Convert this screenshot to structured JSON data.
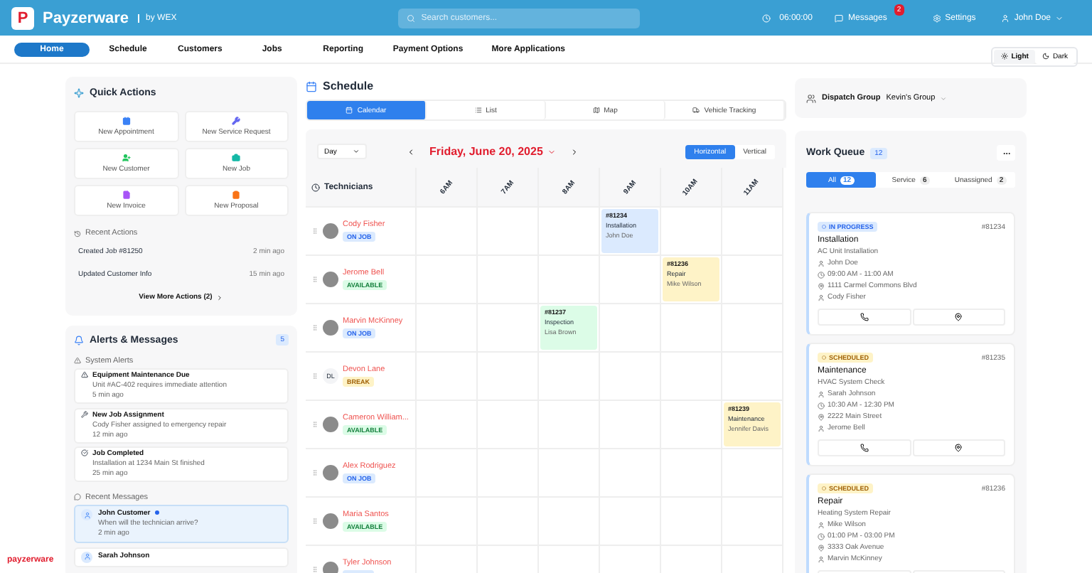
{
  "header": {
    "logo_letter": "P",
    "brand": "Payzerware",
    "by": "by WEX",
    "search_placeholder": "Search customers...",
    "time": "06:00:00",
    "messages": {
      "label": "Messages",
      "badge": "2"
    },
    "settings": "Settings",
    "user": "John Doe",
    "theme": [
      {
        "label": "Light",
        "kind": "sun",
        "selected": true
      },
      {
        "label": "Dark",
        "kind": "moon",
        "selected": false
      }
    ]
  },
  "nav": {
    "items": [
      {
        "label": "Home",
        "selected": true
      },
      {
        "label": "Schedule",
        "selected": false
      },
      {
        "label": "Customers",
        "selected": false
      },
      {
        "label": "Jobs",
        "selected": false
      },
      {
        "label": "Reporting",
        "selected": false
      },
      {
        "label": "Payment Options",
        "selected": false
      },
      {
        "label": "More Applications",
        "selected": false
      }
    ]
  },
  "quick_actions": {
    "title": "Quick Actions",
    "actions": [
      {
        "label": "New Appointment",
        "kind": "calendar",
        "color": "#3b82f6"
      },
      {
        "label": "New Service Request",
        "kind": "wrench",
        "color": "#6366f1"
      },
      {
        "label": "New Customer",
        "kind": "user",
        "color": "#22c55e"
      },
      {
        "label": "New Job",
        "kind": "briefcase",
        "color": "#14b8a6"
      },
      {
        "label": "New Invoice",
        "kind": "invoice",
        "color": "#a855f7"
      },
      {
        "label": "New Proposal",
        "kind": "proposal",
        "color": "#f97316"
      }
    ],
    "recent_title": "Recent Actions",
    "recent": [
      {
        "text": "Created Job #81250",
        "time": "2 min ago"
      },
      {
        "text": "Updated Customer Info",
        "time": "15 min ago"
      }
    ],
    "more": "View More Actions (2)"
  },
  "alerts": {
    "title": "Alerts & Messages",
    "count": "5",
    "system_title": "System Alerts",
    "system": [
      {
        "kind": "warning",
        "title": "Equipment Maintenance Due",
        "detail": "Unit #AC-402 requires immediate attention",
        "time": "5 min ago"
      },
      {
        "kind": "wrench",
        "title": "New Job Assignment",
        "detail": "Cody Fisher assigned to emergency repair",
        "time": "12 min ago"
      },
      {
        "kind": "done",
        "title": "Job Completed",
        "detail": "Installation at 1234 Main St finished",
        "time": "25 min ago"
      }
    ],
    "messages_title": "Recent Messages",
    "messages": [
      {
        "name": "John Customer",
        "unread": true,
        "selected": true,
        "text": "When will the technician arrive?",
        "time": "2 min ago"
      },
      {
        "name": "Sarah Johnson",
        "selected": false
      }
    ]
  },
  "schedule": {
    "title": "Schedule",
    "views": [
      {
        "label": "Calendar",
        "kind": "calendar",
        "selected": true
      },
      {
        "label": "List",
        "kind": "list",
        "selected": false
      },
      {
        "label": "Map",
        "kind": "map",
        "selected": false
      },
      {
        "label": "Vehicle Tracking",
        "kind": "truck",
        "selected": false
      }
    ],
    "range": "Day",
    "date": "Friday, June 20, 2025",
    "orientations": [
      {
        "label": "Horizontal",
        "selected": true
      },
      {
        "label": "Vertical",
        "selected": false
      }
    ],
    "technicians_header": "Technicians",
    "hours": [
      "6AM",
      "7AM",
      "8AM",
      "9AM",
      "10AM",
      "11AM"
    ],
    "technicians": [
      {
        "name": "Cody Fisher",
        "status": "ON JOB",
        "kind": "on_job",
        "cells": [
          null,
          null,
          null,
          {
            "number": "#81234",
            "type": "Installation",
            "customer": "John Doe",
            "color": "#dbeafe"
          },
          null,
          null
        ]
      },
      {
        "name": "Jerome Bell",
        "status": "AVAILABLE",
        "kind": "available",
        "cells": [
          null,
          null,
          null,
          null,
          {
            "number": "#81236",
            "type": "Repair",
            "customer": "Mike Wilson",
            "color": "#fef3c7"
          },
          null
        ]
      },
      {
        "name": "Marvin McKinney",
        "status": "ON JOB",
        "kind": "on_job",
        "cells": [
          null,
          null,
          {
            "number": "#81237",
            "type": "Inspection",
            "customer": "Lisa Brown",
            "color": "#dcfce7"
          },
          null,
          null,
          null
        ]
      },
      {
        "name": "Devon Lane",
        "initials": "DL",
        "status": "BREAK",
        "kind": "break",
        "cells": [
          null,
          null,
          null,
          null,
          null,
          null
        ]
      },
      {
        "name": "Cameron William...",
        "status": "AVAILABLE",
        "kind": "available",
        "cells": [
          null,
          null,
          null,
          null,
          null,
          {
            "number": "#81239",
            "type": "Maintenance",
            "customer": "Jennifer Davis",
            "color": "#fef3c7"
          }
        ]
      },
      {
        "name": "Alex Rodriguez",
        "status": "ON JOB",
        "kind": "on_job",
        "cells": [
          null,
          null,
          null,
          null,
          null,
          null
        ]
      },
      {
        "name": "Maria Santos",
        "status": "AVAILABLE",
        "kind": "available",
        "cells": [
          null,
          null,
          null,
          null,
          null,
          null
        ]
      },
      {
        "name": "Tyler Johnson",
        "kind": "on_job",
        "cells": [
          null,
          null,
          null,
          null,
          null,
          null
        ]
      }
    ]
  },
  "dispatch": {
    "label": "Dispatch Group",
    "value": "Kevin's Group"
  },
  "work_queue": {
    "title": "Work Queue",
    "count": "12",
    "filters": [
      {
        "label": "All",
        "count": "12",
        "selected": true
      },
      {
        "label": "Service",
        "count": "6",
        "selected": false
      },
      {
        "label": "Unassigned",
        "count": "2",
        "selected": false
      }
    ],
    "jobs": [
      {
        "status": "IN PROGRESS",
        "kind": "in_progress",
        "number": "#81234",
        "title": "Installation",
        "subtitle": "AC Unit Installation",
        "customer": "John Doe",
        "time": "09:00 AM - 11:00 AM",
        "address": "1111 Carmel Commons Blvd",
        "technician": "Cody Fisher"
      },
      {
        "status": "SCHEDULED",
        "kind": "scheduled",
        "number": "#81235",
        "title": "Maintenance",
        "subtitle": "HVAC System Check",
        "customer": "Sarah Johnson",
        "time": "10:30 AM - 12:30 PM",
        "address": "2222 Main Street",
        "technician": "Jerome Bell"
      },
      {
        "status": "SCHEDULED",
        "kind": "scheduled",
        "number": "#81236",
        "title": "Repair",
        "subtitle": "Heating System Repair",
        "customer": "Mike Wilson",
        "time": "01:00 PM - 03:00 PM",
        "address": "3333 Oak Avenue",
        "technician": "Marvin McKinney"
      }
    ]
  },
  "footer": {
    "logo": "payzerware"
  }
}
